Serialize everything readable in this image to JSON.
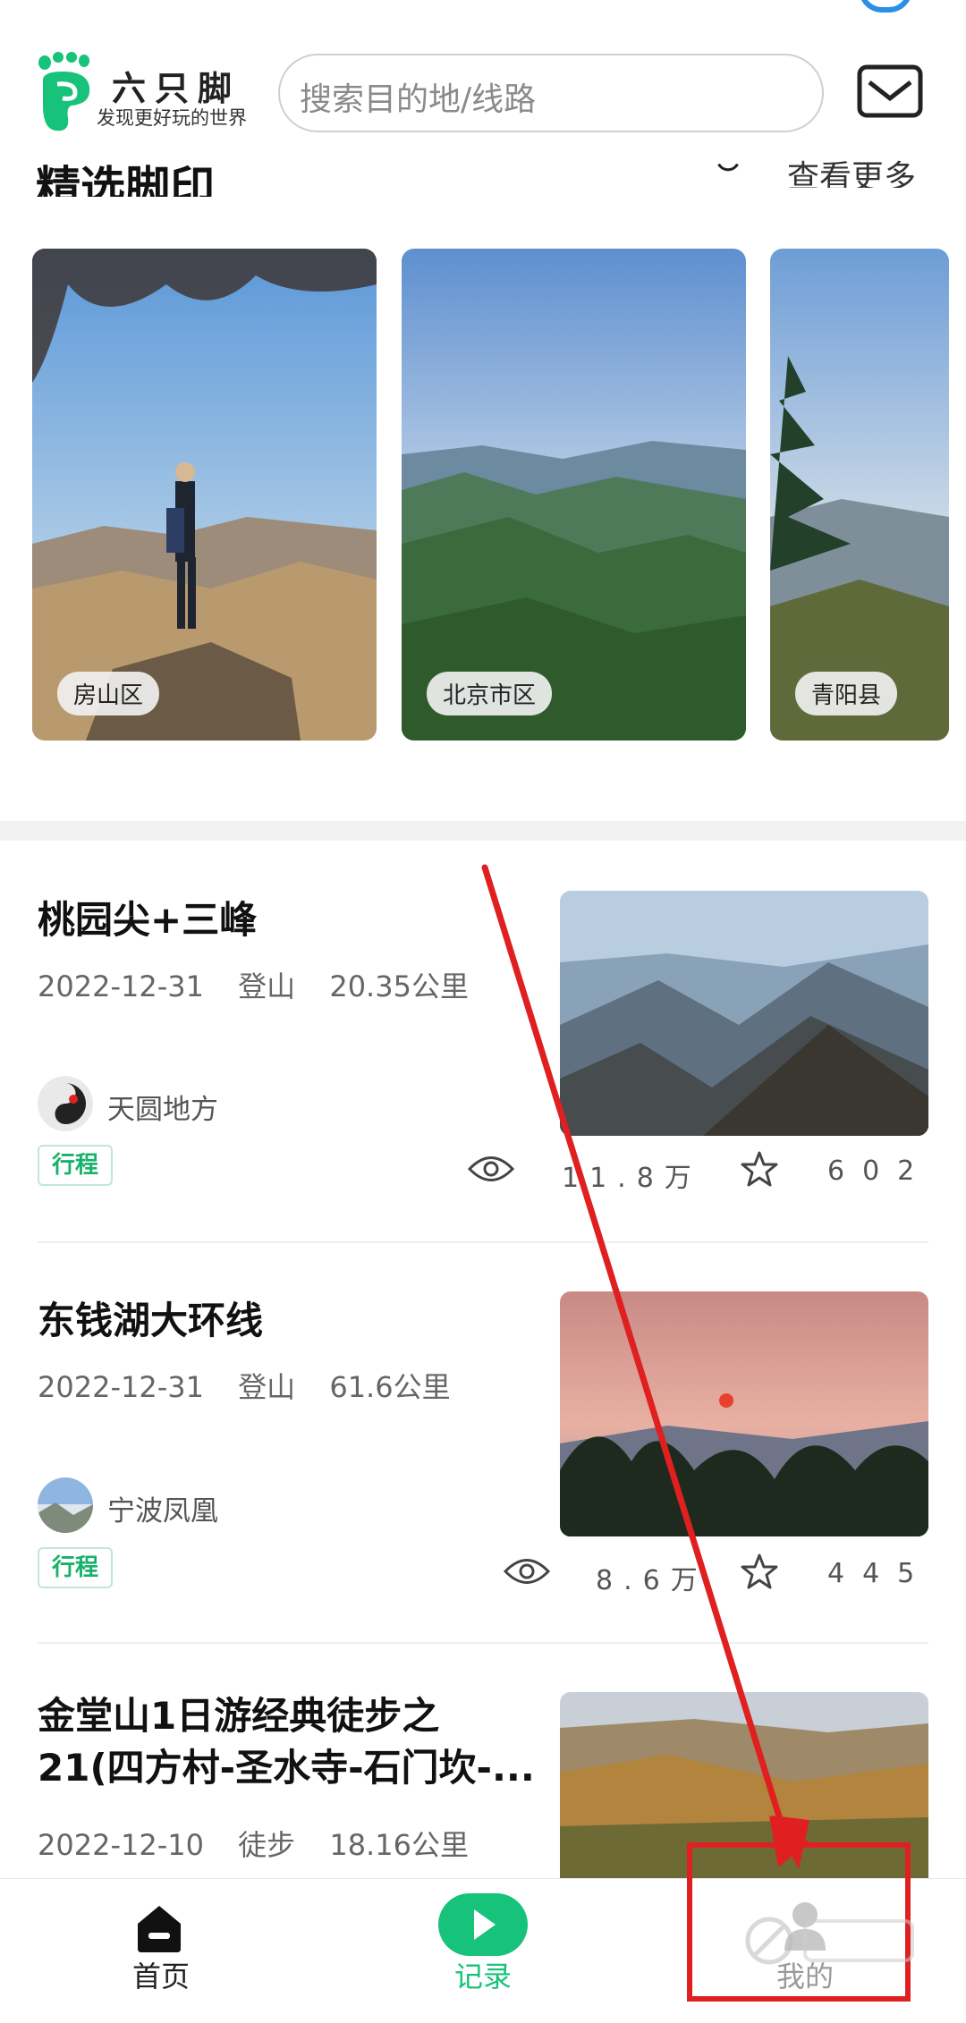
{
  "header": {
    "app_name": "六只脚",
    "slogan": "发现更好玩的世界",
    "search_placeholder": "搜索目的地/线路"
  },
  "section": {
    "title": "精选脚印",
    "more_label": "查看更多"
  },
  "footprints": [
    {
      "location": "房山区"
    },
    {
      "location": "北京市区"
    },
    {
      "location": "青阳县"
    }
  ],
  "routes": [
    {
      "title": "桃园尖+三峰",
      "date": "2022-12-31",
      "activity": "登山",
      "distance": "20.35公里",
      "author": "天圆地方",
      "badge": "行程",
      "views": "11.8万",
      "favorites": "602"
    },
    {
      "title": "东钱湖大环线",
      "date": "2022-12-31",
      "activity": "登山",
      "distance": "61.6公里",
      "author": "宁波凤凰",
      "badge": "行程",
      "views": "8.6万",
      "favorites": "445"
    },
    {
      "title": "金堂山1日游经典徒步之21(四方村-圣水寺-石门坎-...",
      "date": "2022-12-10",
      "activity": "徒步",
      "distance": "18.16公里"
    }
  ],
  "nav": {
    "home": "首页",
    "record": "记录",
    "mine": "我的"
  },
  "colors": {
    "brand_green": "#17c27a",
    "annotation_red": "#e02020"
  }
}
